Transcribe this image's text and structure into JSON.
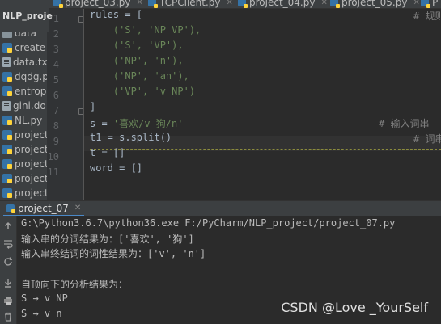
{
  "project": {
    "title": "NLP_proje"
  },
  "tabs": [
    {
      "label": "project_03.py"
    },
    {
      "label": "TCPClient.py"
    },
    {
      "label": "project_04.py"
    },
    {
      "label": "project_05.py"
    },
    {
      "label": "P"
    }
  ],
  "tree": {
    "items": [
      {
        "label": "data",
        "icon": "folder-icon"
      },
      {
        "label": "create_",
        "icon": "python-file-icon"
      },
      {
        "label": "data.tx",
        "icon": "text-file-icon"
      },
      {
        "label": "dqdg.p",
        "icon": "python-file-icon"
      },
      {
        "label": "entrop",
        "icon": "python-file-icon"
      },
      {
        "label": "gini.do",
        "icon": "text-file-icon"
      },
      {
        "label": "NL.py",
        "icon": "python-file-icon"
      },
      {
        "label": "project",
        "icon": "python-file-icon"
      },
      {
        "label": "project",
        "icon": "python-file-icon"
      },
      {
        "label": "project",
        "icon": "python-file-icon"
      },
      {
        "label": "project",
        "icon": "python-file-icon"
      },
      {
        "label": "project",
        "icon": "python-file-icon"
      }
    ]
  },
  "editor": {
    "line_numbers": [
      "1",
      "2",
      "3",
      "4",
      "5",
      "6",
      "7",
      "8",
      "9",
      "10",
      "11"
    ],
    "lines": [
      {
        "plain_before": "rules = [",
        "comment": "# 规则"
      },
      {
        "indent": "    ",
        "string": "('S', 'NP VP'),",
        "plain_after": ""
      },
      {
        "indent": "    ",
        "string": "('S', 'VP'),",
        "plain_after": ""
      },
      {
        "indent": "    ",
        "string": "('NP', 'n'),",
        "plain_after": ""
      },
      {
        "indent": "    ",
        "string": "('NP', 'an'),",
        "plain_after": ""
      },
      {
        "indent": "    ",
        "string": "('VP', 'v NP')",
        "plain_after": ""
      },
      {
        "plain_before": "]"
      },
      {
        "plain_before": "s = ",
        "string": "'喜欢/v 狗/n'",
        "comment": "# 输入词串"
      },
      {
        "plain_before": "t1 = s.split()",
        "comment": "# 词串"
      },
      {
        "plain_before": "t = []"
      },
      {
        "plain_before": "word = []"
      }
    ]
  },
  "run": {
    "tab_label": "project_07",
    "output": [
      "G:\\Python3.6.7\\python36.exe F:/PyCharm/NLP_project/project_07.py",
      "输入串的分词结果为：['喜欢', '狗']",
      "输入串终结词的词性结果为：['v', 'n']",
      "",
      "自顶向下的分析结果为：",
      "S → v NP",
      "S → v n"
    ]
  },
  "watermark": "CSDN @Love _YourSelf",
  "colors": {
    "background": "#2b2b2b",
    "panel": "#3c3f41",
    "string": "#6a8759",
    "comment": "#808080",
    "code": "#a9b7c6"
  }
}
